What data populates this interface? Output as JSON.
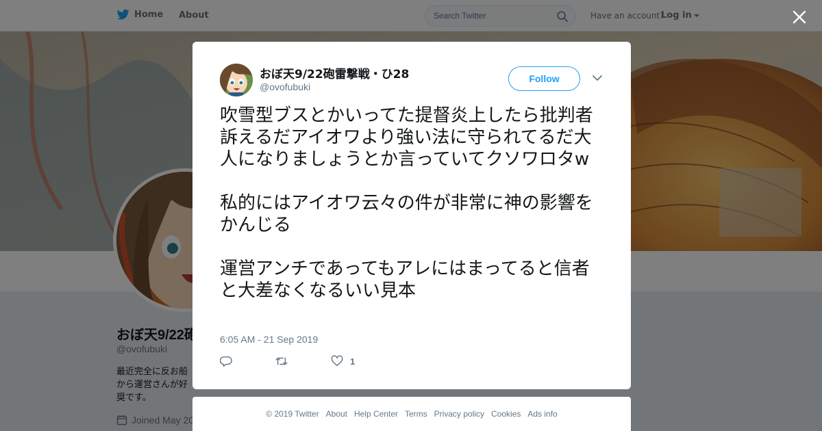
{
  "topnav": {
    "home_label": "Home",
    "about_label": "About",
    "search_placeholder": "Search Twitter",
    "have_account": "Have an account?",
    "login_label": "Log in"
  },
  "profile": {
    "name": "おぼ天9/22砲",
    "handle": "@ovofubuki",
    "bio": "最近完全に反お船 から運営さんが好 奨です。",
    "joined": "Joined May 20"
  },
  "tweet": {
    "author_name": "おぼ天9/22砲雷撃戦・ひ28",
    "author_handle": "@ovofubuki",
    "follow_label": "Follow",
    "paragraphs": [
      "吹雪型ブスとかいってた提督炎上したら批判者訴えるだアイオワより強い法に守られてるだ大人になりましょうとか言っていてクソワロタw",
      "私的にはアイオワ云々の件が非常に神の影響をかんじる",
      "運営アンチであってもアレにはまってると信者と大差なくなるいい見本"
    ],
    "timestamp": "6:05 AM - 21 Sep 2019",
    "like_count": "1"
  },
  "footer": {
    "links": [
      "© 2019 Twitter",
      "About",
      "Help Center",
      "Terms",
      "Privacy policy",
      "Cookies",
      "Ads info"
    ]
  },
  "colors": {
    "brand_blue": "#1da1f2",
    "muted_text": "#657786",
    "background": "#e6ecf0"
  },
  "icons": [
    "twitter-bird-icon",
    "search-icon",
    "close-icon",
    "reply-icon",
    "retweet-icon",
    "heart-icon",
    "chevron-down-icon",
    "calendar-icon"
  ]
}
